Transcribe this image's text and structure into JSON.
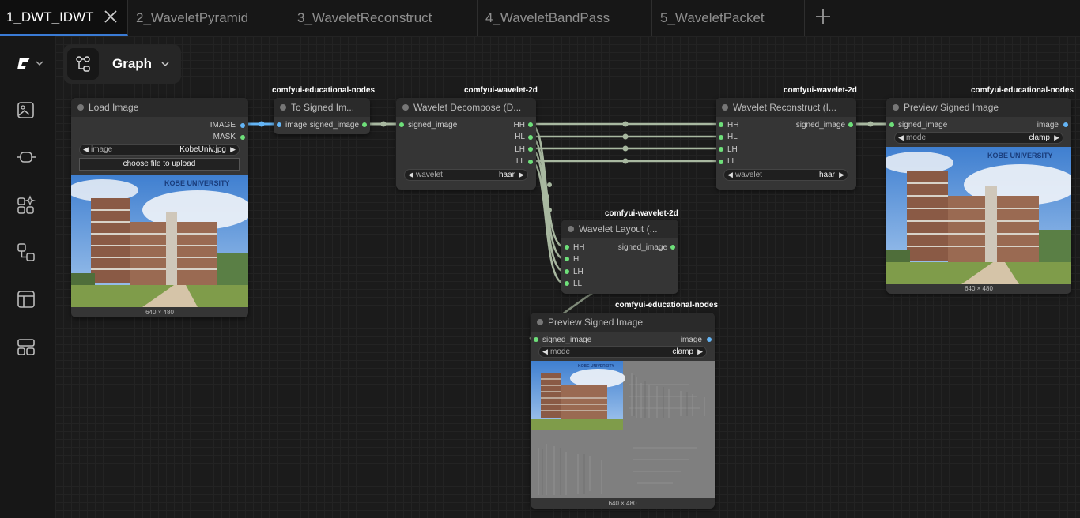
{
  "tabs": [
    {
      "label": "1_DWT_IDWT",
      "active": true
    },
    {
      "label": "2_WaveletPyramid"
    },
    {
      "label": "3_WaveletReconstruct"
    },
    {
      "label": "4_WaveletBandPass"
    },
    {
      "label": "5_WaveletPacket"
    }
  ],
  "toolbar": {
    "graph_label": "Graph"
  },
  "nodes": {
    "load_image": {
      "title": "Load Image",
      "outputs": [
        "IMAGE",
        "MASK"
      ],
      "widget_label": "image",
      "widget_value": "KobeUniv.jpg",
      "upload_label": "choose file to upload",
      "dims": "640 × 480"
    },
    "to_signed": {
      "badge": "comfyui-educational-nodes",
      "title": "To Signed Im...",
      "input": "image",
      "output": "signed_image"
    },
    "decompose": {
      "badge": "comfyui-wavelet-2d",
      "title": "Wavelet Decompose (D...",
      "input": "signed_image",
      "outputs": [
        "HH",
        "HL",
        "LH",
        "LL"
      ],
      "widget_label": "wavelet",
      "widget_value": "haar"
    },
    "reconstruct": {
      "badge": "comfyui-wavelet-2d",
      "title": "Wavelet Reconstruct (I...",
      "inputs": [
        "HH",
        "HL",
        "LH",
        "LL"
      ],
      "output": "signed_image",
      "widget_label": "wavelet",
      "widget_value": "haar"
    },
    "preview_right": {
      "badge": "comfyui-educational-nodes",
      "title": "Preview Signed Image",
      "input": "signed_image",
      "output": "image",
      "widget_label": "mode",
      "widget_value": "clamp",
      "image_caption": "KOBE UNIVERSITY",
      "dims": "640 × 480"
    },
    "layout": {
      "badge": "comfyui-wavelet-2d",
      "title": "Wavelet Layout (...",
      "inputs": [
        "HH",
        "HL",
        "LH",
        "LL"
      ],
      "output": "signed_image"
    },
    "preview_bottom": {
      "badge": "comfyui-educational-nodes",
      "title": "Preview Signed Image",
      "input": "signed_image",
      "output": "image",
      "widget_label": "mode",
      "widget_value": "clamp",
      "image_caption": "KOBE UNIVERSITY",
      "dims": "640 × 480"
    }
  },
  "load_image_caption": "KOBE UNIVERSITY",
  "colors": {
    "accent": "#3a7bd5",
    "link": "#a8b8a0",
    "image_link": "#64b5f6",
    "slot_green": "#6ee07a"
  },
  "icons": [
    "close-icon",
    "plus-icon",
    "comfy-logo-icon",
    "chevron-down-icon",
    "image-gallery-icon",
    "node-library-icon",
    "model-library-icon",
    "workflows-icon",
    "templates-icon",
    "queue-icon",
    "graph-icon"
  ]
}
